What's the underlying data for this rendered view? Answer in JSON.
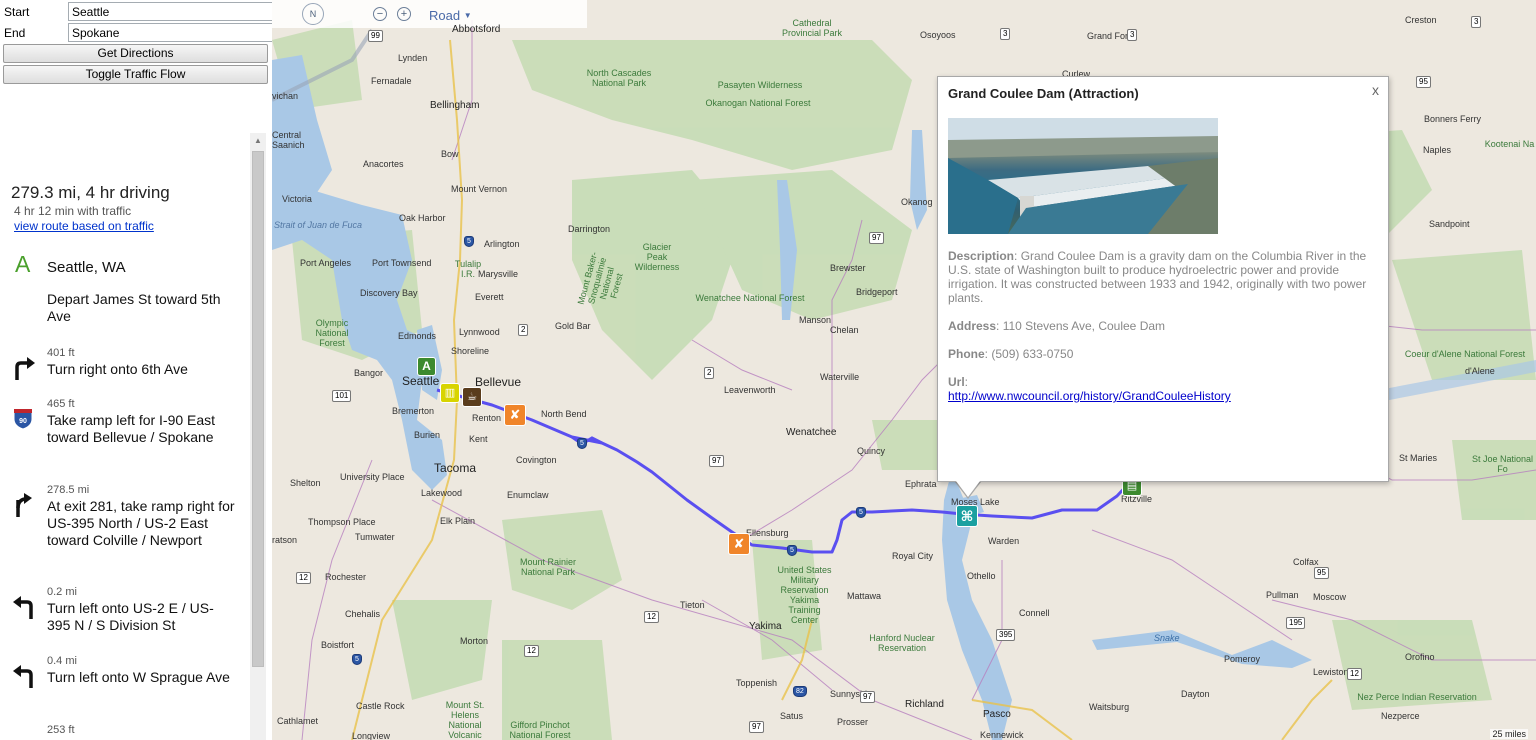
{
  "form": {
    "start_label": "Start",
    "start_value": "Seattle",
    "end_label": "End",
    "end_value": "Spokane",
    "get_directions": "Get Directions",
    "toggle_traffic": "Toggle Traffic Flow"
  },
  "route": {
    "summary": "279.3 mi, 4 hr driving",
    "traffic_note": "4 hr 12 min with traffic",
    "traffic_link": "view route based on traffic",
    "start_marker": "A",
    "start_city": "Seattle, WA",
    "start_instruction": "Depart James St toward 5th Ave",
    "steps": [
      {
        "distance": "401 ft",
        "instruction": "Turn right onto 6th Ave",
        "icon": "turn-right-icon"
      },
      {
        "distance": "465 ft",
        "instruction": "Take ramp left for I-90 East toward Bellevue / Spokane",
        "icon": "interstate-90-icon",
        "shield": "90"
      },
      {
        "distance": "278.5 mi",
        "instruction": "At exit 281, take ramp right for US-395 North / US-2 East toward Colville / Newport",
        "icon": "ramp-right-icon"
      },
      {
        "distance": "0.2 mi",
        "instruction": "Turn left onto US-2 E / US-395 N / S Division St",
        "icon": "turn-left-icon"
      },
      {
        "distance": "0.4 mi",
        "instruction": "Turn left onto W Sprague Ave",
        "icon": "turn-left-icon"
      },
      {
        "distance": "253 ft",
        "instruction": "",
        "icon": ""
      }
    ]
  },
  "map": {
    "compass_label": "N",
    "map_type": "Road",
    "scale_label": "25 miles",
    "start_pin": "A",
    "route_color": "#5a4ff0",
    "labels": [
      {
        "text": "Abbotsford"
      },
      {
        "text": "Lynden"
      },
      {
        "text": "Fernadale"
      },
      {
        "text": "Bellingham"
      },
      {
        "text": "Bow"
      },
      {
        "text": "Anacortes"
      },
      {
        "text": "Mount Vernon"
      },
      {
        "text": "Oak Harbor"
      },
      {
        "text": "Arlington"
      },
      {
        "text": "Port Townsend"
      },
      {
        "text": "Marysville"
      },
      {
        "text": "Everett"
      },
      {
        "text": "Discovery Bay"
      },
      {
        "text": "Edmonds"
      },
      {
        "text": "Lynnwood"
      },
      {
        "text": "Shoreline"
      },
      {
        "text": "Port Angeles"
      },
      {
        "text": "Victoria"
      },
      {
        "text": "Bangor"
      },
      {
        "text": "Seattle"
      },
      {
        "text": "Bellevue"
      },
      {
        "text": "Bremerton"
      },
      {
        "text": "Burien"
      },
      {
        "text": "Renton"
      },
      {
        "text": "Kent"
      },
      {
        "text": "Tacoma"
      },
      {
        "text": "Covington"
      },
      {
        "text": "North Bend"
      },
      {
        "text": "Enumclaw"
      },
      {
        "text": "University Place"
      },
      {
        "text": "Lakewood"
      },
      {
        "text": "Shelton"
      },
      {
        "text": "Thompson Place"
      },
      {
        "text": "Elk Plain"
      },
      {
        "text": "Tumwater"
      },
      {
        "text": "Rochester"
      },
      {
        "text": "Chehalis"
      },
      {
        "text": "Boistfort"
      },
      {
        "text": "Castle Rock"
      },
      {
        "text": "Cathlamet"
      },
      {
        "text": "Longview"
      },
      {
        "text": "Morton"
      },
      {
        "text": "Darrington"
      },
      {
        "text": "Gold Bar"
      },
      {
        "text": "Manson"
      },
      {
        "text": "Chelan"
      },
      {
        "text": "Brewster"
      },
      {
        "text": "Bridgeport"
      },
      {
        "text": "Leavenworth"
      },
      {
        "text": "Waterville"
      },
      {
        "text": "Wenatchee"
      },
      {
        "text": "Quincy"
      },
      {
        "text": "Ephrata"
      },
      {
        "text": "Moses Lake"
      },
      {
        "text": "Warden"
      },
      {
        "text": "Othello"
      },
      {
        "text": "Royal City"
      },
      {
        "text": "Ellensburg"
      },
      {
        "text": "Mattawa"
      },
      {
        "text": "Tieton"
      },
      {
        "text": "Yakima"
      },
      {
        "text": "Toppenish"
      },
      {
        "text": "Sunnyside"
      },
      {
        "text": "Satus"
      },
      {
        "text": "Prosser"
      },
      {
        "text": "Richland"
      },
      {
        "text": "Pasco"
      },
      {
        "text": "Kennewick"
      },
      {
        "text": "Waitsburg"
      },
      {
        "text": "Dayton"
      },
      {
        "text": "Connell"
      },
      {
        "text": "Ritzville"
      },
      {
        "text": "Colfax"
      },
      {
        "text": "Pullman"
      },
      {
        "text": "Moscow"
      },
      {
        "text": "Pomeroy"
      },
      {
        "text": "Lewiston"
      },
      {
        "text": "Orofino"
      },
      {
        "text": "Nezperce"
      },
      {
        "text": "St Maries"
      },
      {
        "text": "Osoyoos"
      },
      {
        "text": "Grand Forks"
      },
      {
        "text": "Curlew"
      },
      {
        "text": "Creston"
      },
      {
        "text": "Bonners Ferry"
      },
      {
        "text": "Naples"
      },
      {
        "text": "Sandpoint"
      },
      {
        "text": "d'Alene"
      },
      {
        "text": "Okanog"
      },
      {
        "text": "Central Saanich"
      },
      {
        "text": "vichan"
      },
      {
        "text": "Snake"
      },
      {
        "text": "ratson"
      }
    ],
    "green_labels": [
      {
        "text": "Cathedral Provincial Park"
      },
      {
        "text": "North Cascades National Park"
      },
      {
        "text": "Pasayten Wilderness"
      },
      {
        "text": "Okanogan National Forest"
      },
      {
        "text": "Glacier Peak Wilderness"
      },
      {
        "text": "Wenatchee National Forest"
      },
      {
        "text": "Mount Baker-Snoqualmie National Forest"
      },
      {
        "text": "Olympic National Forest"
      },
      {
        "text": "Mount Rainier National Park"
      },
      {
        "text": "Mount St. Helens National Volcanic Monument"
      },
      {
        "text": "Gifford Pinchot National Forest"
      },
      {
        "text": "Hanford Nuclear Reservation"
      },
      {
        "text": "United States Military Reservation Yakima Training Center"
      },
      {
        "text": "Nez Perce Indian Reservation"
      },
      {
        "text": "Coeur d'Alene National Forest"
      },
      {
        "text": "St Joe National Fo"
      },
      {
        "text": "Kootenai Na"
      },
      {
        "text": "Strait of Juan de Fuca"
      },
      {
        "text": "Tulalip I.R."
      }
    ],
    "shields": [
      "99",
      "3",
      "3",
      "3",
      "95",
      "5",
      "2",
      "97",
      "2",
      "97",
      "101",
      "12",
      "5",
      "5",
      "12",
      "12",
      "97",
      "97",
      "82",
      "395",
      "195",
      "95",
      "12",
      "3",
      "95"
    ]
  },
  "popup": {
    "title": "Grand Coulee Dam (Attraction)",
    "close": "x",
    "photo_alt": "Grand Coulee Dam aerial photo",
    "description_label": "Description",
    "description": "Grand Coulee Dam is a gravity dam on the Columbia River in the U.S. state of Washington built to produce hydroelectric power and provide irrigation. It was constructed between 1933 and 1942, originally with two power plants.",
    "address_label": "Address",
    "address": "110 Stevens Ave, Coulee Dam",
    "phone_label": "Phone",
    "phone": "(509) 633-0750",
    "url_label": "Url",
    "url": "http://www.nwcouncil.org/history/GrandCouleeHistory"
  }
}
